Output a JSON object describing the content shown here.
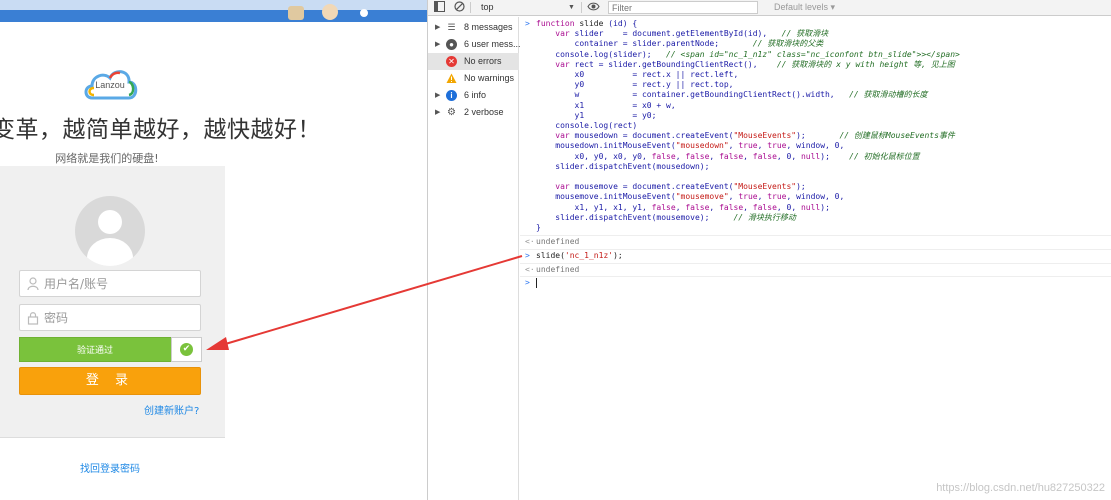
{
  "left": {
    "logo_text": "Lanzou",
    "slogan": "变革，越简单越好，越快越好！",
    "subslogan": "网络就是我们的硬盘!",
    "username_placeholder": "用户名/账号",
    "password_placeholder": "密码",
    "slider_text": "验证通过",
    "login_label": "登 录",
    "signup_link": "创建新账户?",
    "forgot_link": "找回登录密码"
  },
  "devtools": {
    "context": "top",
    "filter_placeholder": "Filter",
    "levels": "Default levels ▾",
    "sidebar": [
      {
        "label": "8 messages",
        "icon": "list-icon",
        "color": "#555555",
        "arrow": true
      },
      {
        "label": "6 user mess...",
        "icon": "user-icon",
        "color": "#555555",
        "arrow": true
      },
      {
        "label": "No errors",
        "icon": "error-icon",
        "color": "#e53935",
        "arrow": false
      },
      {
        "label": "No warnings",
        "icon": "warning-icon",
        "color": "#f2a600",
        "arrow": false
      },
      {
        "label": "6 info",
        "icon": "info-icon",
        "color": "#1e6fd9",
        "arrow": true
      },
      {
        "label": "2 verbose",
        "icon": "verbose-icon",
        "color": "#555555",
        "arrow": true
      }
    ],
    "console": {
      "undefined_1": "undefined",
      "call": "slide('nc_1_n1z');",
      "undefined_2": "undefined"
    }
  },
  "watermark": "https://blog.csdn.net/hu827250322",
  "colors": {
    "slider_green": "#7ac23c",
    "login_orange": "#f9a10c",
    "link_blue": "#1e88e5",
    "arrow_red": "#e53935"
  }
}
